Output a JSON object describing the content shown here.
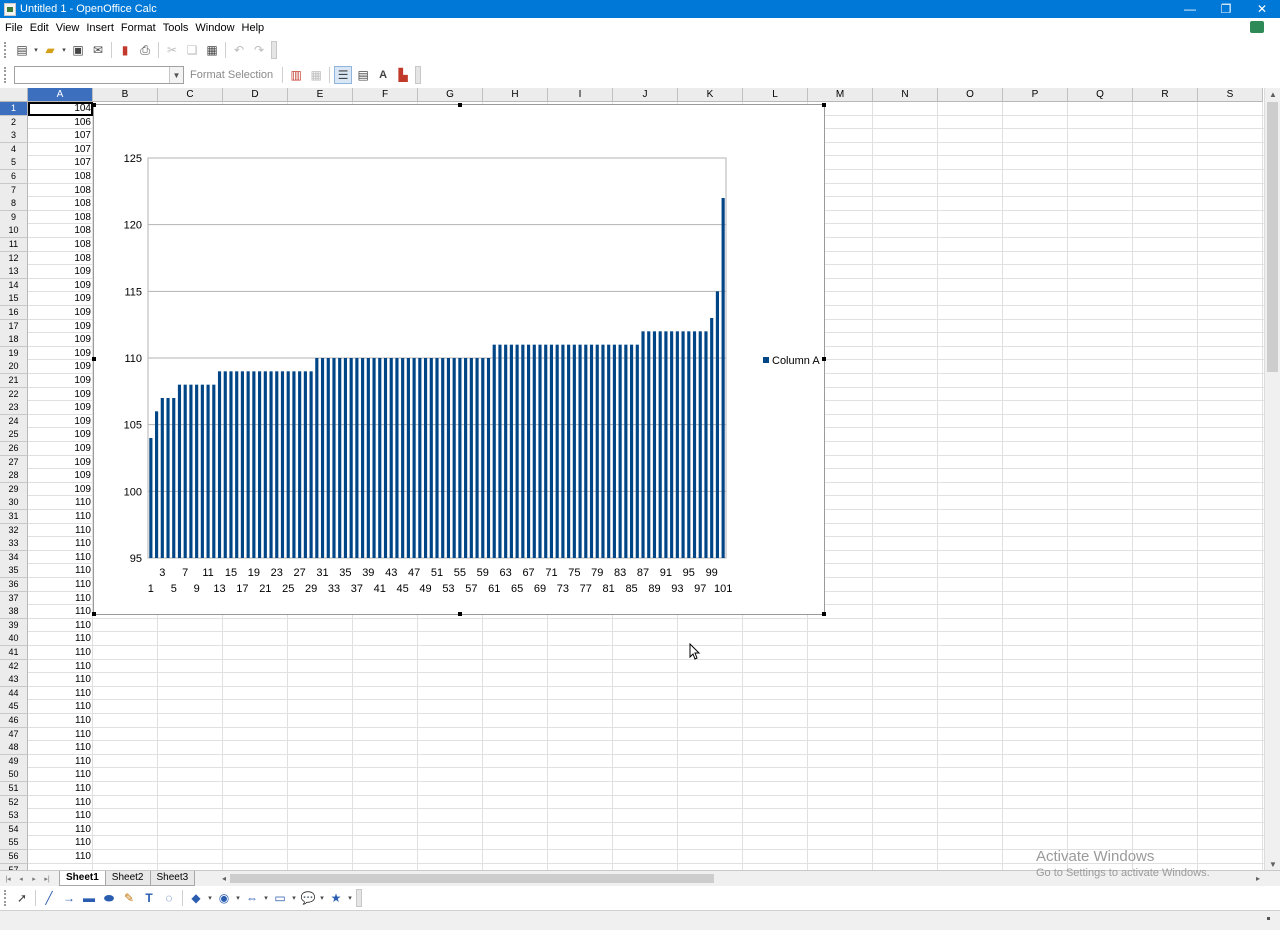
{
  "window": {
    "title": "Untitled 1 - OpenOffice Calc",
    "min": "—",
    "max": "❐",
    "close": "✕"
  },
  "menu": [
    "File",
    "Edit",
    "View",
    "Insert",
    "Format",
    "Tools",
    "Window",
    "Help"
  ],
  "toolbar2": {
    "format_selection": "Format Selection"
  },
  "columns": [
    "A",
    "B",
    "C",
    "D",
    "E",
    "F",
    "G",
    "H",
    "I",
    "J",
    "K",
    "L",
    "M",
    "N",
    "O",
    "P",
    "Q",
    "R",
    "S"
  ],
  "selected_column": "A",
  "rows": [
    "104",
    "106",
    "107",
    "107",
    "107",
    "108",
    "108",
    "108",
    "108",
    "108",
    "108",
    "108",
    "109",
    "109",
    "109",
    "109",
    "109",
    "109",
    "109",
    "109",
    "109",
    "109",
    "109",
    "109",
    "109",
    "109",
    "109",
    "109",
    "109",
    "110",
    "110",
    "110",
    "110",
    "110",
    "110",
    "110",
    "110",
    "110",
    "110",
    "110",
    "110",
    "110",
    "110",
    "110",
    "110",
    "110",
    "110",
    "110",
    "110",
    "110",
    "110",
    "110",
    "110",
    "110",
    "110",
    "110"
  ],
  "sheet_tabs": [
    "Sheet1",
    "Sheet2",
    "Sheet3"
  ],
  "active_sheet": "Sheet1",
  "watermark": {
    "line1": "Activate Windows",
    "line2": "Go to Settings to activate Windows."
  },
  "colors": {
    "bar": "#004586",
    "titlebar": "#0078d7",
    "selection": "#3d6fbf"
  },
  "chart_data": {
    "type": "bar",
    "categories_count": 101,
    "values": [
      104,
      106,
      107,
      107,
      107,
      108,
      108,
      108,
      108,
      108,
      108,
      108,
      109,
      109,
      109,
      109,
      109,
      109,
      109,
      109,
      109,
      109,
      109,
      109,
      109,
      109,
      109,
      109,
      109,
      110,
      110,
      110,
      110,
      110,
      110,
      110,
      110,
      110,
      110,
      110,
      110,
      110,
      110,
      110,
      110,
      110,
      110,
      110,
      110,
      110,
      110,
      110,
      110,
      110,
      110,
      110,
      110,
      110,
      110,
      110,
      111,
      111,
      111,
      111,
      111,
      111,
      111,
      111,
      111,
      111,
      111,
      111,
      111,
      111,
      111,
      111,
      111,
      111,
      111,
      111,
      111,
      111,
      111,
      111,
      111,
      111,
      112,
      112,
      112,
      112,
      112,
      112,
      112,
      112,
      112,
      112,
      112,
      112,
      113,
      115,
      122
    ],
    "series_name": "Column A",
    "ylim": [
      95,
      125
    ],
    "yticks": [
      95,
      100,
      105,
      110,
      115,
      120,
      125
    ],
    "xtick_odd_upper": [
      "3",
      "7",
      "11",
      "15",
      "19",
      "23",
      "27",
      "31",
      "35",
      "39",
      "43",
      "47",
      "51",
      "55",
      "59",
      "63",
      "67",
      "71",
      "75",
      "79",
      "83",
      "87",
      "91",
      "95",
      "99"
    ],
    "xtick_odd_lower": [
      "1",
      "5",
      "9",
      "13",
      "17",
      "21",
      "25",
      "29",
      "33",
      "37",
      "41",
      "45",
      "49",
      "53",
      "57",
      "61",
      "65",
      "69",
      "73",
      "77",
      "81",
      "85",
      "89",
      "93",
      "97",
      "101"
    ],
    "grid": true,
    "legend": "right"
  }
}
